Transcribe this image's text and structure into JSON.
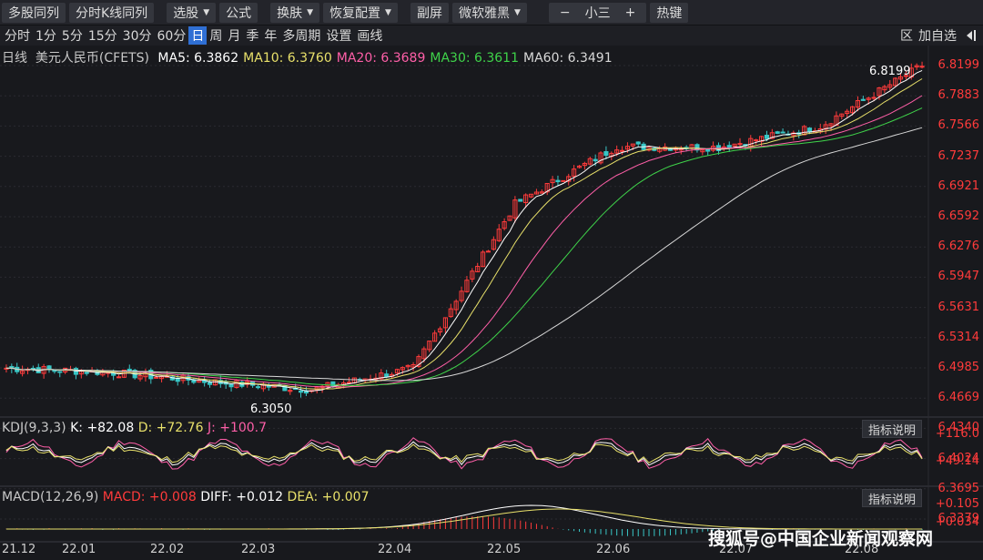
{
  "toolbar": {
    "items": [
      {
        "label": "多股同列",
        "caret": false
      },
      {
        "label": "分时K线同列",
        "caret": false
      },
      {
        "label": "选股",
        "caret": true
      },
      {
        "label": "公式",
        "caret": false
      },
      {
        "label": "换肤",
        "caret": true
      },
      {
        "label": "恢复配置",
        "caret": true
      },
      {
        "label": "副屏",
        "caret": false
      },
      {
        "label": "微软雅黑",
        "caret": true
      }
    ],
    "font_size_minus": "−",
    "font_size_label": "小三",
    "font_size_plus": "+",
    "hotkey_label": "热键"
  },
  "periods": {
    "items": [
      "分时",
      "1分",
      "5分",
      "15分",
      "30分",
      "60分",
      "日",
      "周",
      "月",
      "季",
      "年",
      "多周期",
      "设置",
      "画线"
    ],
    "active": "日",
    "right_items": [
      "区",
      "加自选"
    ]
  },
  "main_header": {
    "period": "日线",
    "name": "美元人民币(CFETS)",
    "ma": [
      {
        "label": "MA5: 6.3862",
        "color": "#ffffff"
      },
      {
        "label": "MA10: 6.3760",
        "color": "#e8e06a"
      },
      {
        "label": "MA20: 6.3689",
        "color": "#ff5fa8"
      },
      {
        "label": "MA30: 6.3611",
        "color": "#3fd34a"
      },
      {
        "label": "MA60: 6.3491",
        "color": "#d8d8d8"
      }
    ]
  },
  "kdj": {
    "label": "KDJ(9,3,3)",
    "k": "K: +82.08",
    "d": "D: +72.76",
    "j": "J: +100.7",
    "colors": {
      "k": "#ffffff",
      "d": "#e8e06a",
      "j": "#ff5fa8"
    },
    "y_labels": [
      "+116.0",
      "+49.14"
    ],
    "button": "指标说明"
  },
  "macd": {
    "label": "MACD(12,26,9)",
    "macd": "MACD: +0.008",
    "diff": "DIFF: +0.012",
    "dea": "DEA: +0.007",
    "y_labels": [
      "+0.105",
      "+0.034"
    ],
    "button": "指标说明"
  },
  "price_axis": [
    "6.8199",
    "6.7883",
    "6.7566",
    "6.7237",
    "6.6921",
    "6.6592",
    "6.6276",
    "6.5947",
    "6.5631",
    "6.5314",
    "6.4985",
    "6.4669",
    "6.4340",
    "6.4024",
    "6.3695",
    "6.3379"
  ],
  "time_axis": [
    "21.12",
    "22.01",
    "22.02",
    "22.03",
    "22.04",
    "22.05",
    "22.06",
    "22.07",
    "22.08"
  ],
  "annotations": {
    "high": "6.8199",
    "low": "6.3050"
  },
  "colors": {
    "up": "#ff3b3b",
    "down": "#39c6c6",
    "bg": "#18191d",
    "grid": "#2a2b31"
  },
  "watermark": "搜狐号@中国企业新闻观察网",
  "chart_data": {
    "type": "candlestick",
    "title": "美元人民币(CFETS)",
    "y_range": [
      6.305,
      6.8199
    ],
    "months": [
      "21.12",
      "22.01",
      "22.02",
      "22.03",
      "22.04",
      "22.05",
      "22.06",
      "22.07",
      "22.08"
    ],
    "monthly_approx_close": [
      6.372,
      6.366,
      6.352,
      6.34,
      6.372,
      6.615,
      6.7,
      6.699,
      6.73,
      6.8199
    ],
    "ma_latest": {
      "MA5": 6.3862,
      "MA10": 6.376,
      "MA20": 6.3689,
      "MA30": 6.3611,
      "MA60": 6.3491
    },
    "kdj_latest": {
      "K": 82.08,
      "D": 72.76,
      "J": 100.7
    },
    "macd_latest": {
      "MACD": 0.008,
      "DIFF": 0.012,
      "DEA": 0.007
    }
  }
}
